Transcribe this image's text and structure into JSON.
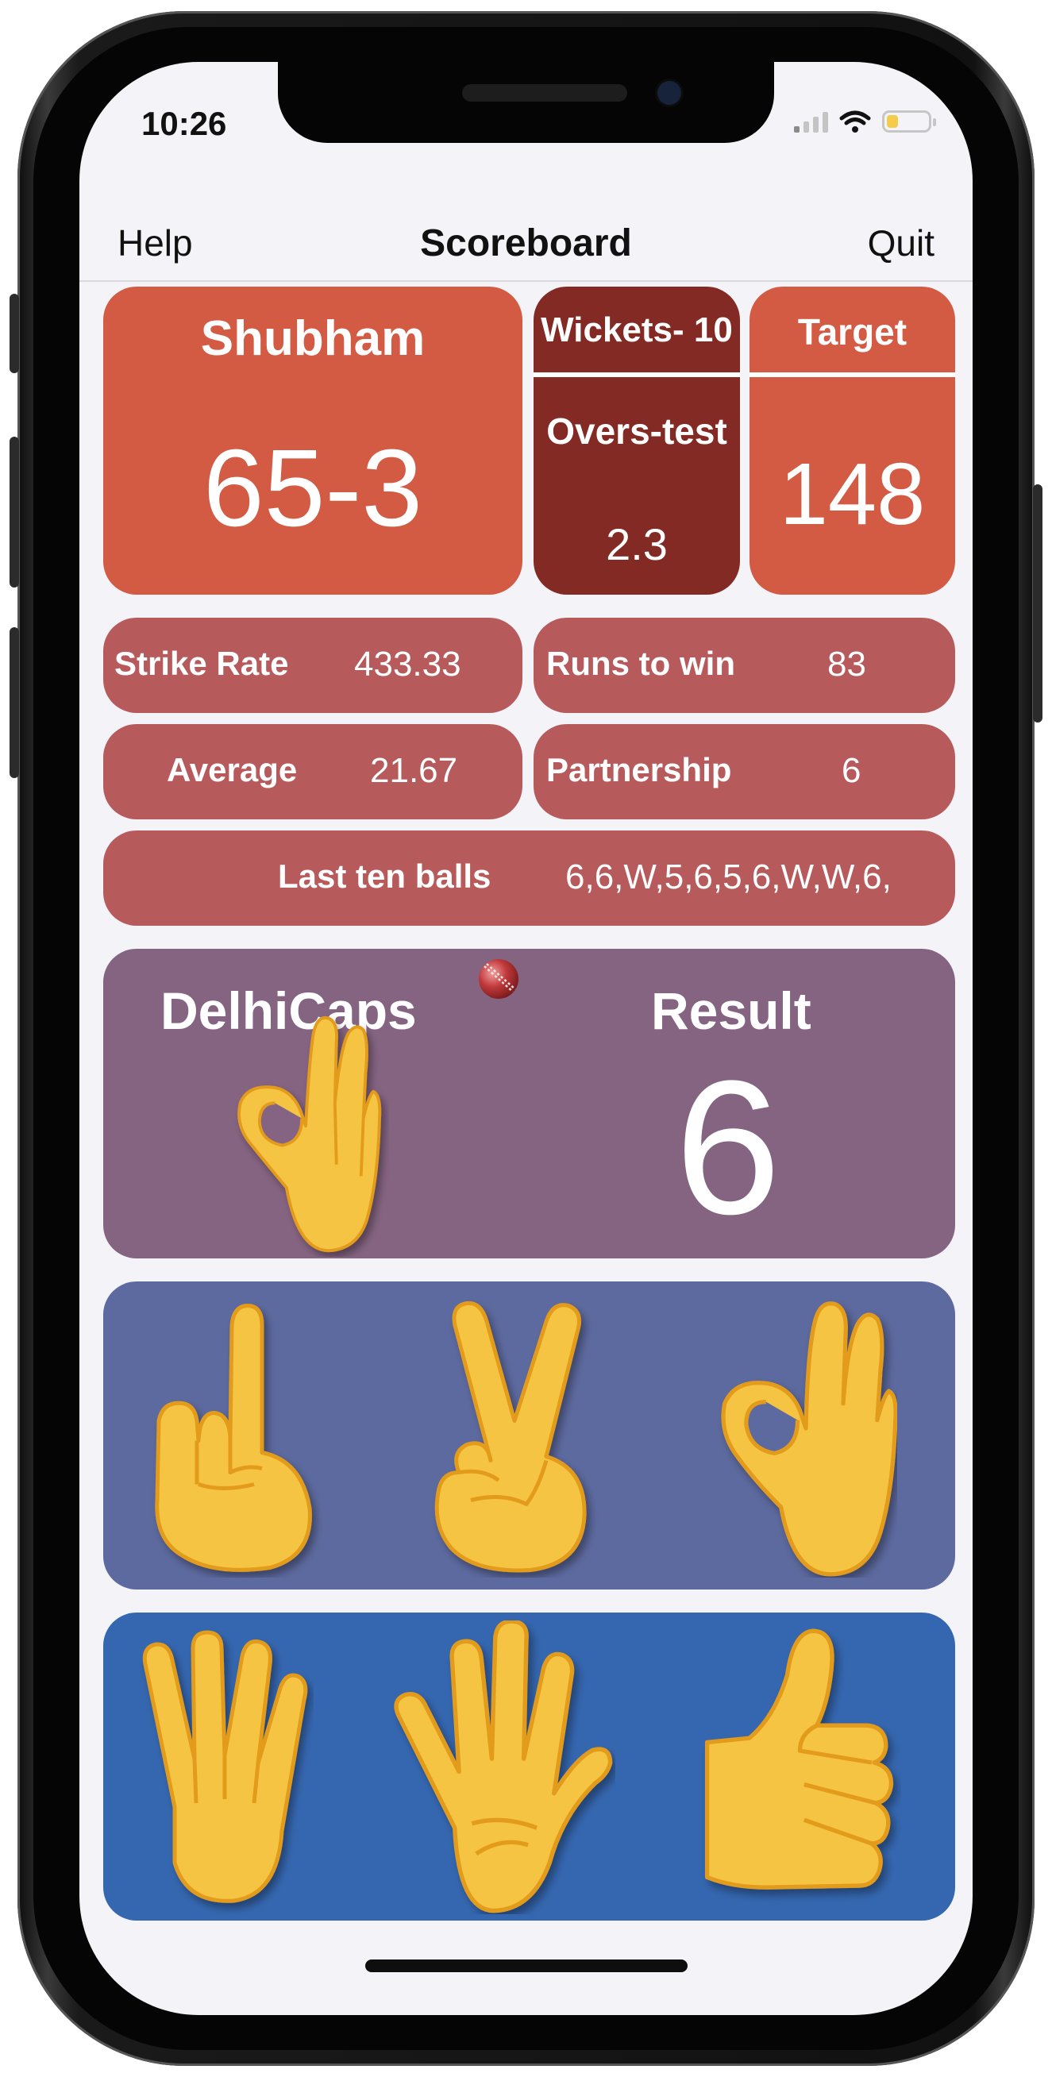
{
  "status_bar": {
    "time": "10:26",
    "battery_level": 0.25,
    "battery_color": "#f5cc4a"
  },
  "nav": {
    "left": "Help",
    "title": "Scoreboard",
    "right": "Quit"
  },
  "score": {
    "player": "Shubham",
    "value": "65-3"
  },
  "wickets": {
    "label": "Wickets- 10"
  },
  "overs": {
    "label": "Overs-test",
    "value": "2.3"
  },
  "target": {
    "label": "Target",
    "value": "148"
  },
  "stats": {
    "strike_rate_label": "Strike Rate",
    "strike_rate_value": "433.33",
    "runs_to_win_label": "Runs to win",
    "runs_to_win_value": "83",
    "average_label": "Average",
    "average_value": "21.67",
    "partnership_label": "Partnership",
    "partnership_value": "6",
    "last_ten_label": "Last ten balls",
    "last_ten_value": "6,6,W,5,6,5,6,W,W,6,"
  },
  "bowler": {
    "team": "DelhiCaps",
    "result_label": "Result",
    "result_value": "6",
    "bowled_gesture": "ok-hand-icon"
  },
  "choices": {
    "row1": [
      "one-finger-hand-icon",
      "victory-hand-icon",
      "ok-hand-icon"
    ],
    "row2": [
      "four-fingers-hand-icon",
      "open-palm-hand-icon",
      "thumbs-up-icon"
    ]
  },
  "colors": {
    "orange": "#d35a43",
    "maroon": "#842a24",
    "rose": "#b75a5c",
    "purple": "#856482",
    "indigo": "#5d6a9f",
    "blue": "#3567b0",
    "hand": "#f5c443"
  }
}
